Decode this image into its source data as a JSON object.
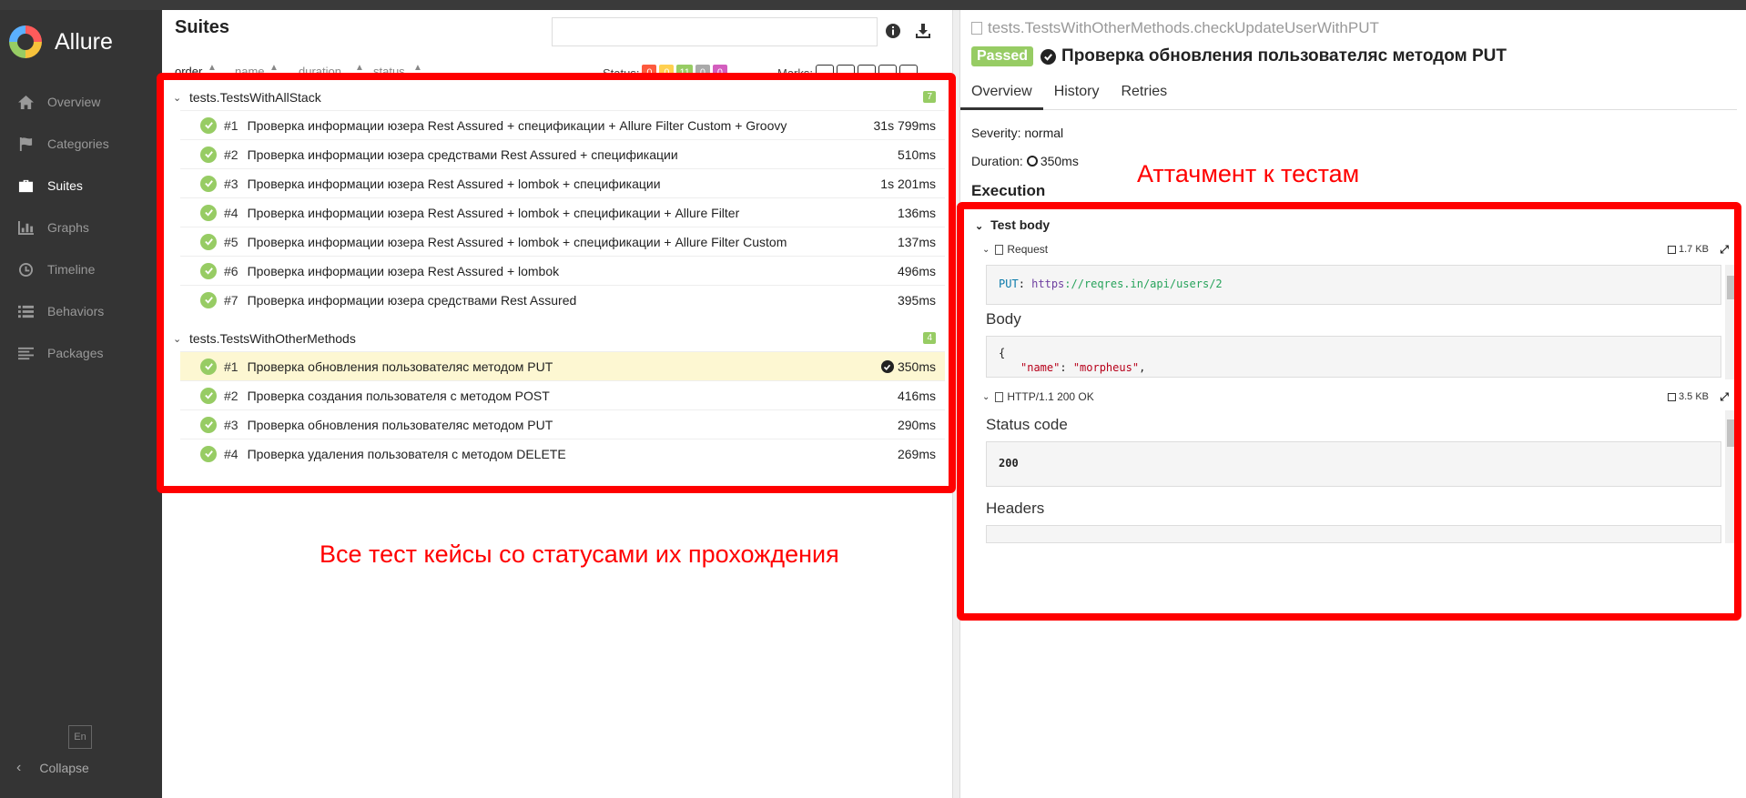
{
  "app": {
    "name": "Allure",
    "language": "En",
    "collapse_label": "Collapse"
  },
  "sidebar": {
    "items": [
      {
        "label": "Overview",
        "icon": "home-icon"
      },
      {
        "label": "Categories",
        "icon": "flag-icon"
      },
      {
        "label": "Suites",
        "icon": "briefcase-icon",
        "active": true
      },
      {
        "label": "Graphs",
        "icon": "bar-chart-icon"
      },
      {
        "label": "Timeline",
        "icon": "clock-icon"
      },
      {
        "label": "Behaviors",
        "icon": "list-icon"
      },
      {
        "label": "Packages",
        "icon": "align-left-icon"
      }
    ]
  },
  "suites": {
    "title": "Suites",
    "sort": {
      "order": "order",
      "name": "name",
      "duration": "duration",
      "status": "status"
    },
    "status_label": "Status:",
    "status_counts": [
      {
        "value": "0",
        "color": "#fd5a3e"
      },
      {
        "value": "0",
        "color": "#ffd050"
      },
      {
        "value": "11",
        "color": "#97cc64"
      },
      {
        "value": "0",
        "color": "#aaaaaa"
      },
      {
        "value": "0",
        "color": "#d35ebe"
      }
    ],
    "marks_label": "Marks:",
    "groups": [
      {
        "name": "tests.TestsWithAllStack",
        "count": "7",
        "tests": [
          {
            "num": "#1",
            "name": "Проверка информации юзера Rest Assured + спецификации + Allure Filter Custom + Groovy",
            "duration": "31s 799ms"
          },
          {
            "num": "#2",
            "name": "Проверка информации юзера средствами Rest Assured + спецификации",
            "duration": "510ms"
          },
          {
            "num": "#3",
            "name": "Проверка информации юзера Rest Assured + lombok + спецификации",
            "duration": "1s 201ms"
          },
          {
            "num": "#4",
            "name": "Проверка информации юзера Rest Assured + lombok + спецификации + Allure Filter",
            "duration": "136ms"
          },
          {
            "num": "#5",
            "name": "Проверка информации юзера Rest Assured + lombok + спецификации + Allure Filter Custom",
            "duration": "137ms"
          },
          {
            "num": "#6",
            "name": "Проверка информации юзера Rest Assured + lombok",
            "duration": "496ms"
          },
          {
            "num": "#7",
            "name": "Проверка информации юзера средствами Rest Assured",
            "duration": "395ms"
          }
        ]
      },
      {
        "name": "tests.TestsWithOtherMethods",
        "count": "4",
        "tests": [
          {
            "num": "#1",
            "name": "Проверка обновления пользователяс методом PUT",
            "duration": "350ms",
            "selected": true
          },
          {
            "num": "#2",
            "name": "Проверка создания пользователя с методом POST",
            "duration": "416ms"
          },
          {
            "num": "#3",
            "name": "Проверка обновления пользователяс методом PUT",
            "duration": "290ms"
          },
          {
            "num": "#4",
            "name": "Проверка удаления пользователя с методом DELETE",
            "duration": "269ms"
          }
        ]
      }
    ]
  },
  "detail": {
    "path": "tests.TestsWithOtherMethods.checkUpdateUserWithPUT",
    "status": "Passed",
    "title": "Проверка обновления пользователяс методом PUT",
    "tabs": [
      "Overview",
      "History",
      "Retries"
    ],
    "severity": "Severity: normal",
    "duration_label": "Duration:",
    "duration_value": "350ms",
    "execution": "Execution",
    "test_body": "Test body",
    "request": {
      "label": "Request",
      "size": "1.7 KB",
      "method": "PUT",
      "url_prefix": "https",
      "url_rest": "://reqres.in/api/users/2",
      "body_label": "Body",
      "json_open": "{",
      "json_key": "\"name\"",
      "json_val": "\"morpheus\""
    },
    "response": {
      "label": "HTTP/1.1 200 OK",
      "size": "3.5 KB",
      "status_code_label": "Status code",
      "status_code": "200",
      "headers_label": "Headers"
    }
  },
  "annotations": {
    "left_caption": "Все тест кейсы со статусами их прохождения",
    "right_caption": "Аттачмент к тестам",
    "color": "#ff0000"
  }
}
